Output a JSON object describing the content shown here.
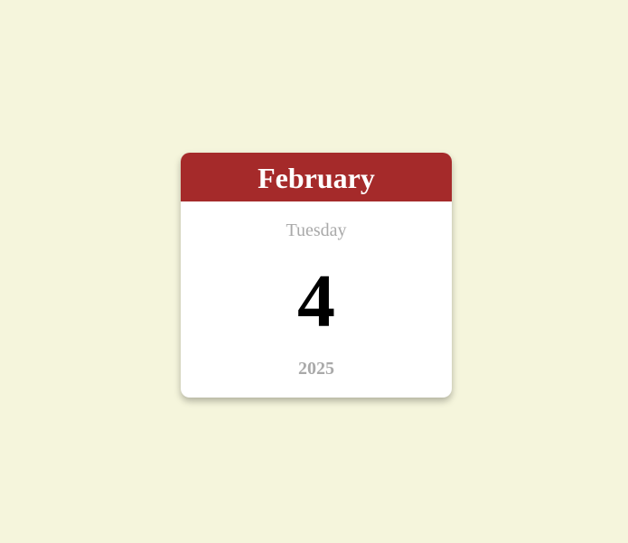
{
  "calendar": {
    "month": "February",
    "weekday": "Tuesday",
    "day": "4",
    "year": "2025"
  },
  "colors": {
    "background": "#f5f5dc",
    "header": "#a52a2a",
    "header_text": "#ffffff",
    "muted_text": "#a9a9a9",
    "day_text": "#000000"
  }
}
